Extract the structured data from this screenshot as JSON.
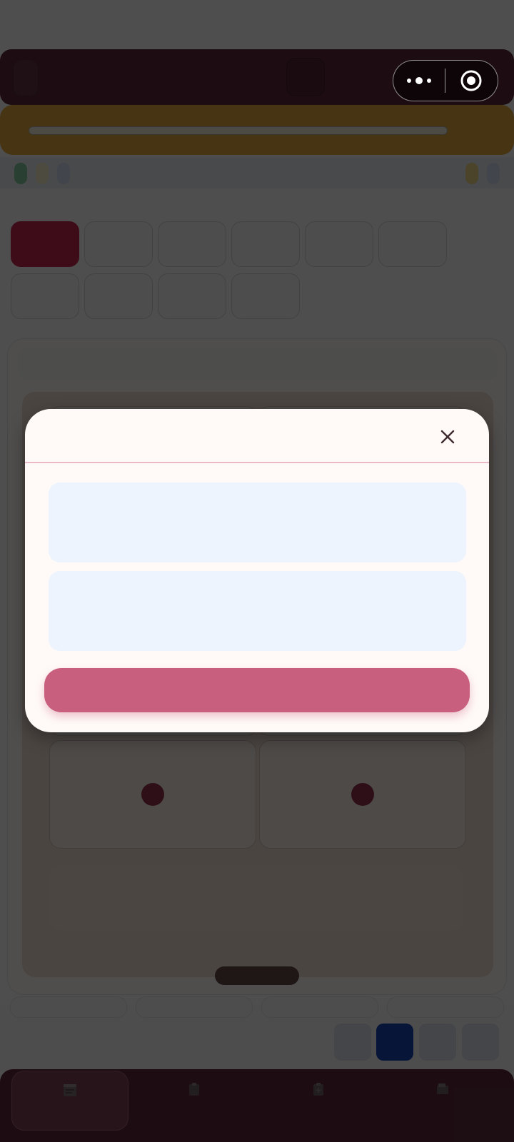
{
  "modal": {
    "title": "",
    "options": [
      "",
      ""
    ],
    "confirm_label": ""
  },
  "colors": {
    "header_bar": "#5a2a3b",
    "banner": "#d9a33a",
    "active_category": "#c0284f",
    "modal_button": "#c85f7f",
    "option_card": "#edf4fe",
    "active_page": "#1845ae"
  },
  "icons": {
    "close": "close-icon",
    "more": "more-dots-icon",
    "target": "target-icon"
  }
}
